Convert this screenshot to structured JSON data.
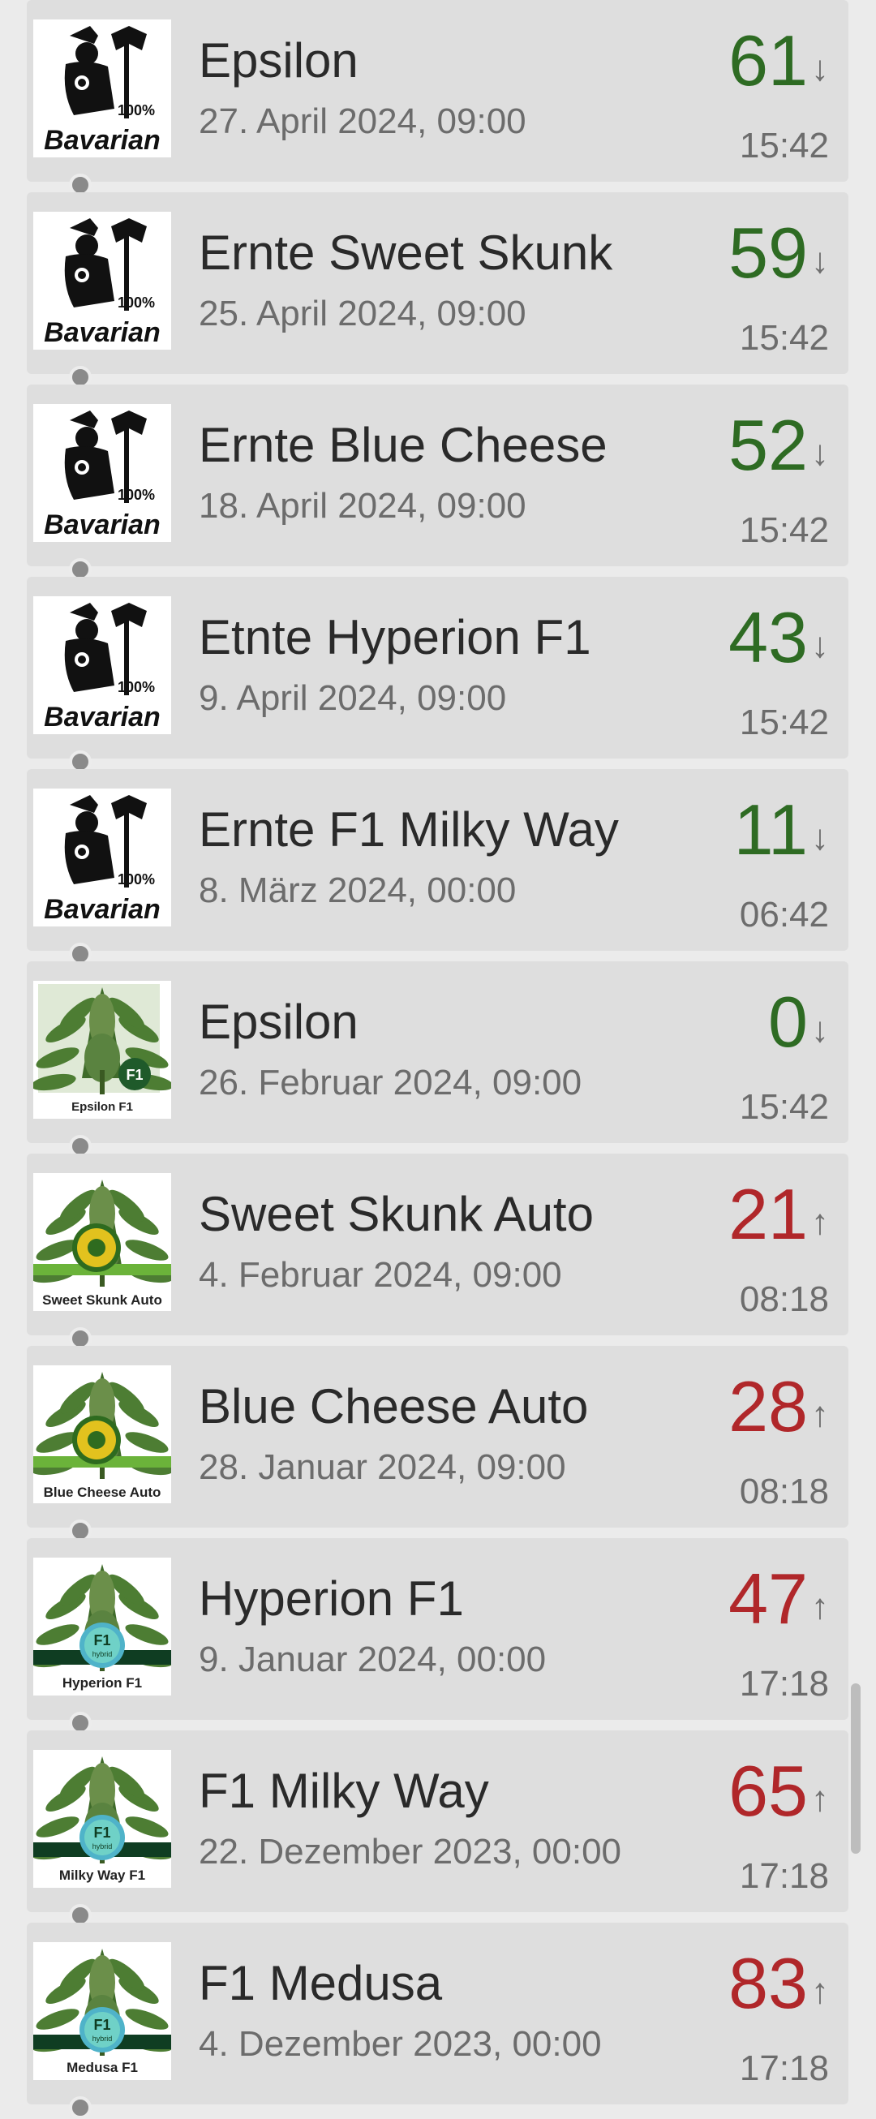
{
  "colors": {
    "down": "#2e6b23",
    "up": "#b0272a",
    "arrow": "#6f6f6f"
  },
  "entries": [
    {
      "name": "Epsilon",
      "date": "27. April 2024, 09:00",
      "value": "61",
      "arrow": "↓",
      "trend": "down",
      "time": "15:42",
      "thumb": "bavarian-logo",
      "thumb_text": [
        "100%",
        "Bavarian"
      ]
    },
    {
      "name": "Ernte Sweet Skunk",
      "date": "25. April 2024, 09:00",
      "value": "59",
      "arrow": "↓",
      "trend": "down",
      "time": "15:42",
      "thumb": "bavarian-logo",
      "thumb_text": [
        "100%",
        "Bavarian"
      ]
    },
    {
      "name": "Ernte Blue Cheese",
      "date": "18. April 2024, 09:00",
      "value": "52",
      "arrow": "↓",
      "trend": "down",
      "time": "15:42",
      "thumb": "bavarian-logo",
      "thumb_text": [
        "100%",
        "Bavarian"
      ]
    },
    {
      "name": "Etnte Hyperion F1",
      "date": "9. April 2024, 09:00",
      "value": "43",
      "arrow": "↓",
      "trend": "down",
      "time": "15:42",
      "thumb": "bavarian-logo",
      "thumb_text": [
        "100%",
        "Bavarian"
      ]
    },
    {
      "name": "Ernte F1 Milky Way",
      "date": "8. März 2024, 00:00",
      "value": "11",
      "arrow": "↓",
      "trend": "down",
      "time": "06:42",
      "thumb": "bavarian-logo",
      "thumb_text": [
        "100%",
        "Bavarian"
      ]
    },
    {
      "name": "Epsilon",
      "date": "26. Februar 2024, 09:00",
      "value": "0",
      "arrow": "↓",
      "trend": "down",
      "time": "15:42",
      "thumb": "plant-f1-badge",
      "thumb_text": [
        "F1",
        "Epsilon F1"
      ]
    },
    {
      "name": "Sweet Skunk Auto",
      "date": "4. Februar 2024, 09:00",
      "value": "21",
      "arrow": "↑",
      "trend": "up",
      "time": "08:18",
      "thumb": "plant-auto-badge",
      "thumb_text": [
        "Sweet Skunk Auto"
      ]
    },
    {
      "name": "Blue Cheese Auto",
      "date": "28. Januar 2024, 09:00",
      "value": "28",
      "arrow": "↑",
      "trend": "up",
      "time": "08:18",
      "thumb": "plant-auto-badge",
      "thumb_text": [
        "Blue Cheese Auto"
      ]
    },
    {
      "name": "Hyperion F1",
      "date": "9. Januar 2024, 00:00",
      "value": "47",
      "arrow": "↑",
      "trend": "up",
      "time": "17:18",
      "thumb": "plant-hybrid-badge",
      "thumb_text": [
        "F1",
        "hybrid",
        "Hyperion F1"
      ]
    },
    {
      "name": "F1 Milky Way",
      "date": "22. Dezember 2023, 00:00",
      "value": "65",
      "arrow": "↑",
      "trend": "up",
      "time": "17:18",
      "thumb": "plant-hybrid-badge",
      "thumb_text": [
        "F1",
        "hybrid",
        "Milky Way F1"
      ]
    },
    {
      "name": "F1 Medusa",
      "date": "4. Dezember 2023, 00:00",
      "value": "83",
      "arrow": "↑",
      "trend": "up",
      "time": "17:18",
      "thumb": "plant-hybrid-badge",
      "thumb_text": [
        "F1",
        "hybrid",
        "Medusa F1"
      ]
    }
  ]
}
